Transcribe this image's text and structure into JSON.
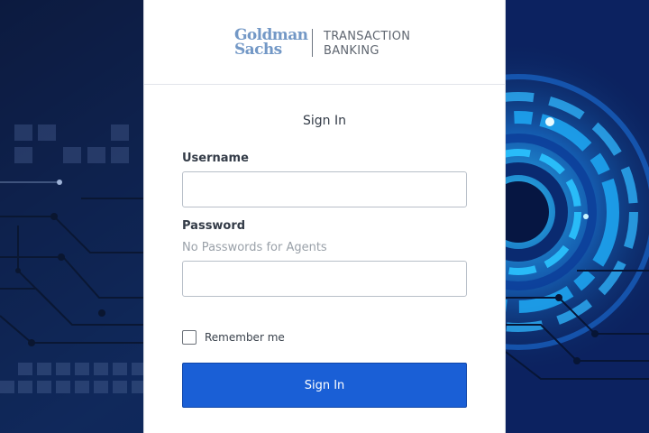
{
  "brand": {
    "logo_line1": "Goldman",
    "logo_line2": "Sachs",
    "product_line1": "TRANSACTION",
    "product_line2": "BANKING",
    "logo_color": "#7398c6"
  },
  "form": {
    "title": "Sign In",
    "username_label": "Username",
    "username_value": "",
    "password_label": "Password",
    "password_hint": "No Passwords for Agents",
    "password_value": "",
    "remember_label": "Remember me",
    "remember_checked": false,
    "submit_label": "Sign In",
    "accent_color": "#1a5fd6"
  }
}
